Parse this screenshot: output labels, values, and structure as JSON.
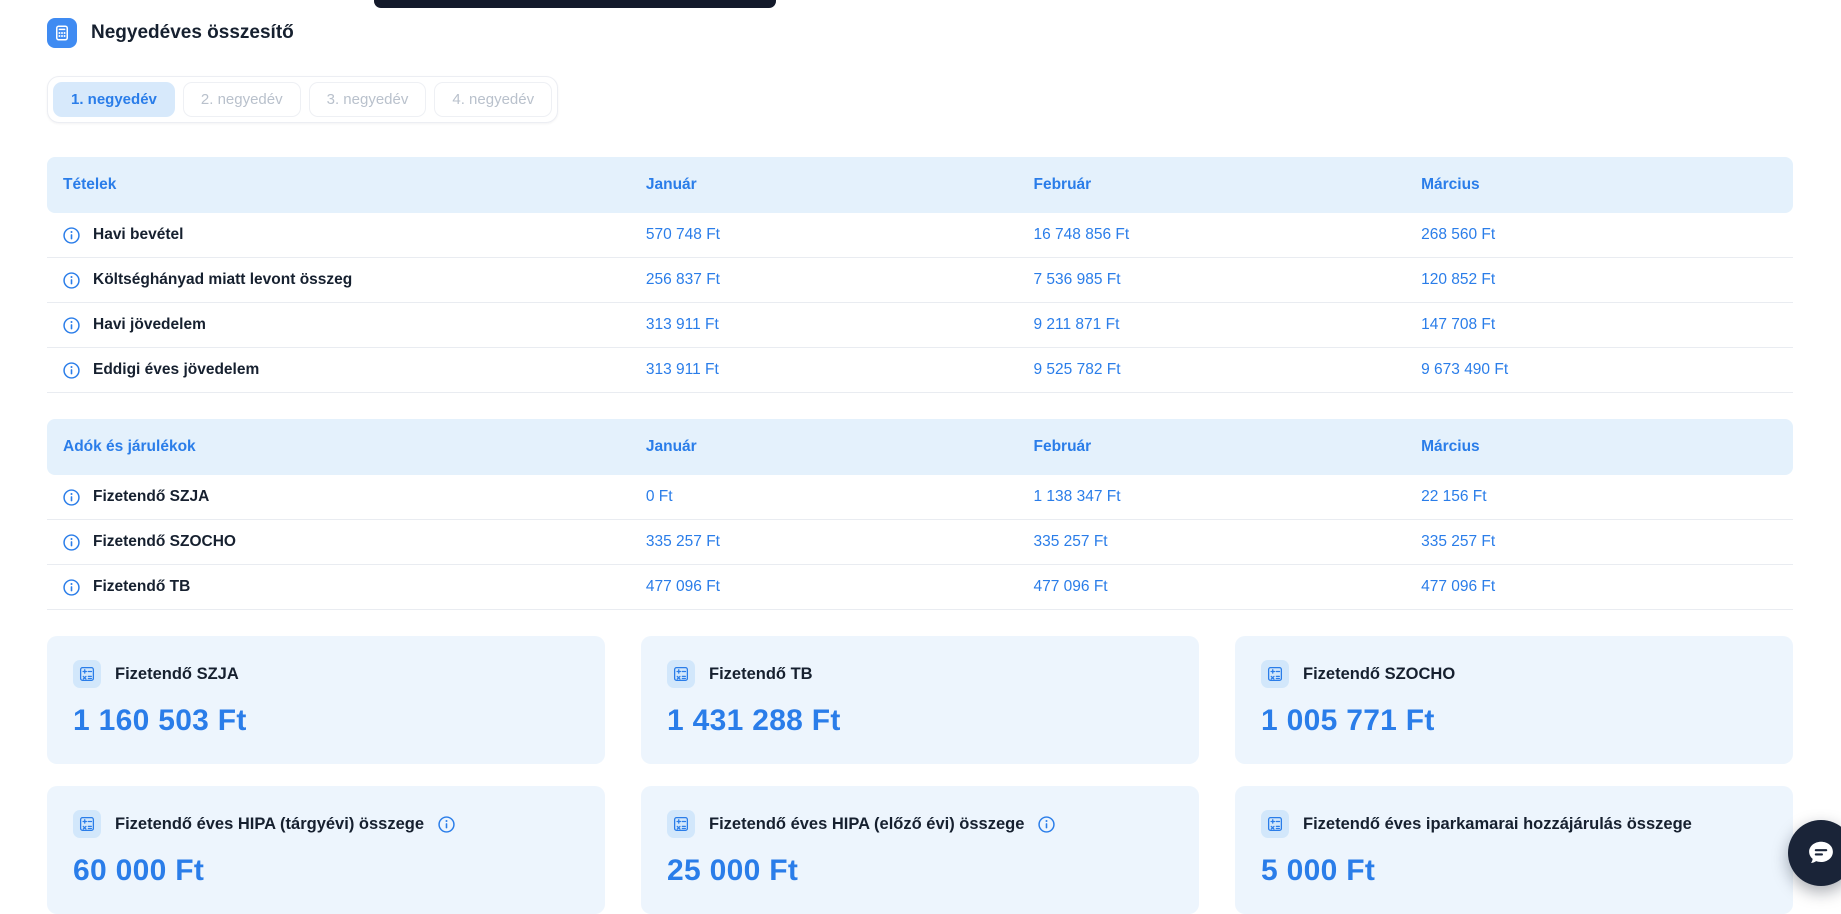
{
  "page": {
    "title": "Negyedéves összesítő"
  },
  "tabs": [
    {
      "label": "1. negyedév",
      "active": true
    },
    {
      "label": "2. negyedév",
      "active": false
    },
    {
      "label": "3. negyedév",
      "active": false
    },
    {
      "label": "4. negyedév",
      "active": false
    }
  ],
  "months": [
    "Január",
    "Február",
    "Március"
  ],
  "tables": [
    {
      "header": "Tételek",
      "rows": [
        {
          "label": "Havi bevétel",
          "values": [
            "570 748 Ft",
            "16 748 856 Ft",
            "268 560 Ft"
          ]
        },
        {
          "label": "Költséghányad miatt levont összeg",
          "values": [
            "256 837 Ft",
            "7 536 985 Ft",
            "120 852 Ft"
          ]
        },
        {
          "label": "Havi jövedelem",
          "values": [
            "313 911 Ft",
            "9 211 871 Ft",
            "147 708 Ft"
          ]
        },
        {
          "label": "Eddigi éves jövedelem",
          "values": [
            "313 911 Ft",
            "9 525 782 Ft",
            "9 673 490 Ft"
          ]
        }
      ]
    },
    {
      "header": "Adók és járulékok",
      "rows": [
        {
          "label": "Fizetendő SZJA",
          "values": [
            "0 Ft",
            "1 138 347 Ft",
            "22 156 Ft"
          ]
        },
        {
          "label": "Fizetendő SZOCHO",
          "values": [
            "335 257 Ft",
            "335 257 Ft",
            "335 257 Ft"
          ]
        },
        {
          "label": "Fizetendő TB",
          "values": [
            "477 096 Ft",
            "477 096 Ft",
            "477 096 Ft"
          ]
        }
      ]
    }
  ],
  "summary_rows": [
    [
      {
        "label": "Fizetendő SZJA",
        "amount": "1 160 503 Ft"
      },
      {
        "label": "Fizetendő TB",
        "amount": "1 431 288 Ft"
      },
      {
        "label": "Fizetendő SZOCHO",
        "amount": "1 005 771 Ft"
      }
    ],
    [
      {
        "label": "Fizetendő éves HIPA (tárgyévi) összege",
        "amount": "60 000 Ft",
        "has_info": true
      },
      {
        "label": "Fizetendő éves HIPA (előző évi) összege",
        "amount": "25 000 Ft",
        "has_info": true
      },
      {
        "label": "Fizetendő éves iparkamarai hozzájárulás összege",
        "amount": "5 000 Ft",
        "has_info": false
      }
    ]
  ],
  "colors": {
    "accent": "#2a7de9",
    "dark-text": "#16202f",
    "table-header-bg": "#e4f1fc",
    "card-bg": "#edf5fd",
    "card-icon-bg": "#d2e7fb",
    "active-tab-bg": "#d7e9fb",
    "inactive-tab-text": "#b9c1cc",
    "row-border": "#e9ecf1",
    "chat-fab-bg": "#1a2438"
  }
}
